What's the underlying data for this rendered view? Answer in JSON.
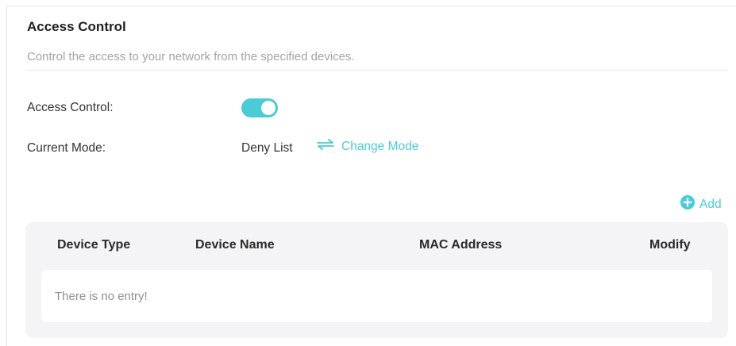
{
  "section": {
    "title": "Access Control",
    "subtitle": "Control the access to your network from the specified devices."
  },
  "access_control": {
    "label": "Access Control:",
    "enabled": true
  },
  "current_mode": {
    "label": "Current Mode:",
    "value": "Deny List",
    "change_label": "Change Mode"
  },
  "add": {
    "label": "Add"
  },
  "table": {
    "columns": [
      "Device Type",
      "Device Name",
      "MAC Address",
      "Modify"
    ],
    "empty_message": "There is no entry!"
  },
  "colors": {
    "accent": "#4acbd6",
    "title_text": "#1f1f1f",
    "muted_text": "#a3a3a3",
    "table_background": "#f4f4f6"
  },
  "icons": {
    "change_mode": "swap-arrows-icon",
    "add": "plus-circle-icon"
  }
}
